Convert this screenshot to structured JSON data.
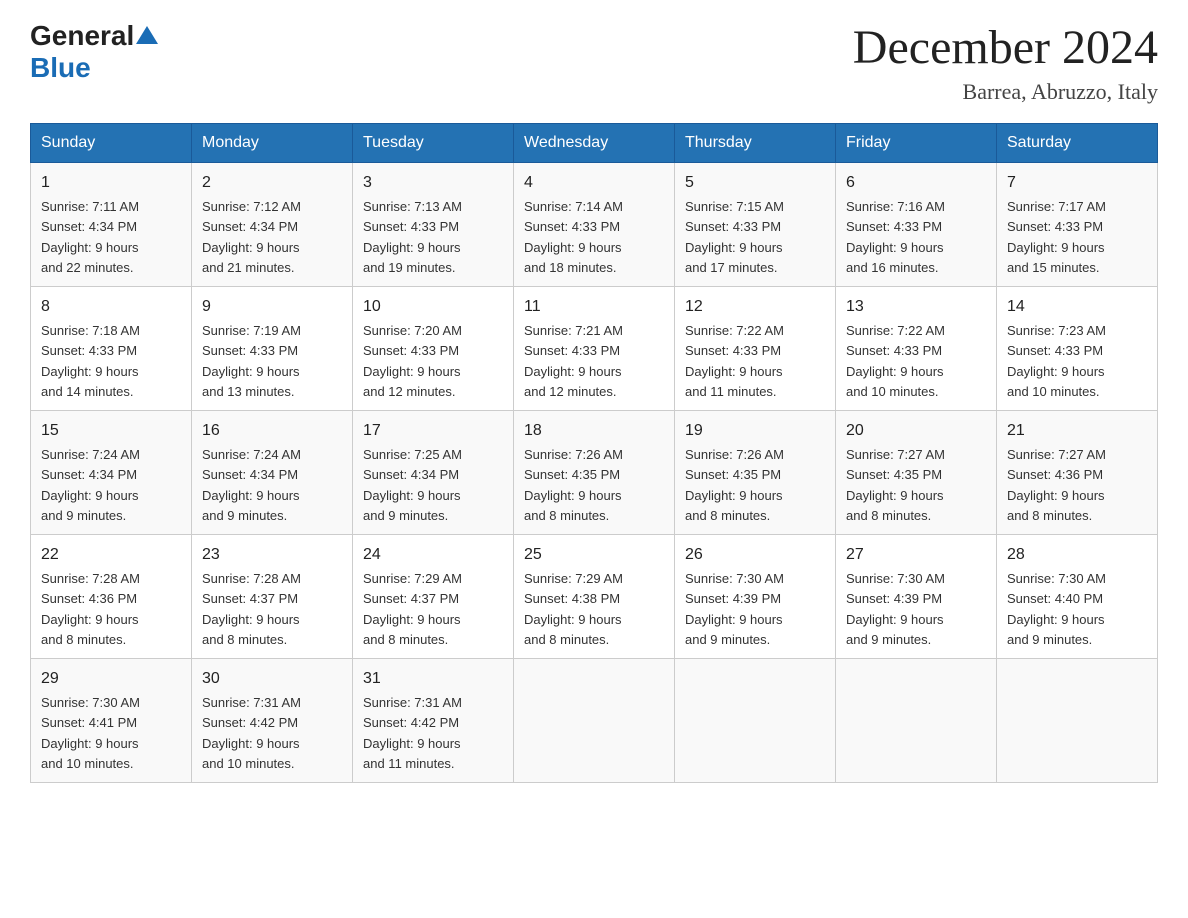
{
  "header": {
    "logo_general": "General",
    "logo_blue": "Blue",
    "title": "December 2024",
    "subtitle": "Barrea, Abruzzo, Italy"
  },
  "days_of_week": [
    "Sunday",
    "Monday",
    "Tuesday",
    "Wednesday",
    "Thursday",
    "Friday",
    "Saturday"
  ],
  "weeks": [
    [
      {
        "day": "1",
        "sunrise": "7:11 AM",
        "sunset": "4:34 PM",
        "daylight": "9 hours and 22 minutes."
      },
      {
        "day": "2",
        "sunrise": "7:12 AM",
        "sunset": "4:34 PM",
        "daylight": "9 hours and 21 minutes."
      },
      {
        "day": "3",
        "sunrise": "7:13 AM",
        "sunset": "4:33 PM",
        "daylight": "9 hours and 19 minutes."
      },
      {
        "day": "4",
        "sunrise": "7:14 AM",
        "sunset": "4:33 PM",
        "daylight": "9 hours and 18 minutes."
      },
      {
        "day": "5",
        "sunrise": "7:15 AM",
        "sunset": "4:33 PM",
        "daylight": "9 hours and 17 minutes."
      },
      {
        "day": "6",
        "sunrise": "7:16 AM",
        "sunset": "4:33 PM",
        "daylight": "9 hours and 16 minutes."
      },
      {
        "day": "7",
        "sunrise": "7:17 AM",
        "sunset": "4:33 PM",
        "daylight": "9 hours and 15 minutes."
      }
    ],
    [
      {
        "day": "8",
        "sunrise": "7:18 AM",
        "sunset": "4:33 PM",
        "daylight": "9 hours and 14 minutes."
      },
      {
        "day": "9",
        "sunrise": "7:19 AM",
        "sunset": "4:33 PM",
        "daylight": "9 hours and 13 minutes."
      },
      {
        "day": "10",
        "sunrise": "7:20 AM",
        "sunset": "4:33 PM",
        "daylight": "9 hours and 12 minutes."
      },
      {
        "day": "11",
        "sunrise": "7:21 AM",
        "sunset": "4:33 PM",
        "daylight": "9 hours and 12 minutes."
      },
      {
        "day": "12",
        "sunrise": "7:22 AM",
        "sunset": "4:33 PM",
        "daylight": "9 hours and 11 minutes."
      },
      {
        "day": "13",
        "sunrise": "7:22 AM",
        "sunset": "4:33 PM",
        "daylight": "9 hours and 10 minutes."
      },
      {
        "day": "14",
        "sunrise": "7:23 AM",
        "sunset": "4:33 PM",
        "daylight": "9 hours and 10 minutes."
      }
    ],
    [
      {
        "day": "15",
        "sunrise": "7:24 AM",
        "sunset": "4:34 PM",
        "daylight": "9 hours and 9 minutes."
      },
      {
        "day": "16",
        "sunrise": "7:24 AM",
        "sunset": "4:34 PM",
        "daylight": "9 hours and 9 minutes."
      },
      {
        "day": "17",
        "sunrise": "7:25 AM",
        "sunset": "4:34 PM",
        "daylight": "9 hours and 9 minutes."
      },
      {
        "day": "18",
        "sunrise": "7:26 AM",
        "sunset": "4:35 PM",
        "daylight": "9 hours and 8 minutes."
      },
      {
        "day": "19",
        "sunrise": "7:26 AM",
        "sunset": "4:35 PM",
        "daylight": "9 hours and 8 minutes."
      },
      {
        "day": "20",
        "sunrise": "7:27 AM",
        "sunset": "4:35 PM",
        "daylight": "9 hours and 8 minutes."
      },
      {
        "day": "21",
        "sunrise": "7:27 AM",
        "sunset": "4:36 PM",
        "daylight": "9 hours and 8 minutes."
      }
    ],
    [
      {
        "day": "22",
        "sunrise": "7:28 AM",
        "sunset": "4:36 PM",
        "daylight": "9 hours and 8 minutes."
      },
      {
        "day": "23",
        "sunrise": "7:28 AM",
        "sunset": "4:37 PM",
        "daylight": "9 hours and 8 minutes."
      },
      {
        "day": "24",
        "sunrise": "7:29 AM",
        "sunset": "4:37 PM",
        "daylight": "9 hours and 8 minutes."
      },
      {
        "day": "25",
        "sunrise": "7:29 AM",
        "sunset": "4:38 PM",
        "daylight": "9 hours and 8 minutes."
      },
      {
        "day": "26",
        "sunrise": "7:30 AM",
        "sunset": "4:39 PM",
        "daylight": "9 hours and 9 minutes."
      },
      {
        "day": "27",
        "sunrise": "7:30 AM",
        "sunset": "4:39 PM",
        "daylight": "9 hours and 9 minutes."
      },
      {
        "day": "28",
        "sunrise": "7:30 AM",
        "sunset": "4:40 PM",
        "daylight": "9 hours and 9 minutes."
      }
    ],
    [
      {
        "day": "29",
        "sunrise": "7:30 AM",
        "sunset": "4:41 PM",
        "daylight": "9 hours and 10 minutes."
      },
      {
        "day": "30",
        "sunrise": "7:31 AM",
        "sunset": "4:42 PM",
        "daylight": "9 hours and 10 minutes."
      },
      {
        "day": "31",
        "sunrise": "7:31 AM",
        "sunset": "4:42 PM",
        "daylight": "9 hours and 11 minutes."
      },
      null,
      null,
      null,
      null
    ]
  ],
  "labels": {
    "sunrise": "Sunrise:",
    "sunset": "Sunset:",
    "daylight": "Daylight:"
  }
}
